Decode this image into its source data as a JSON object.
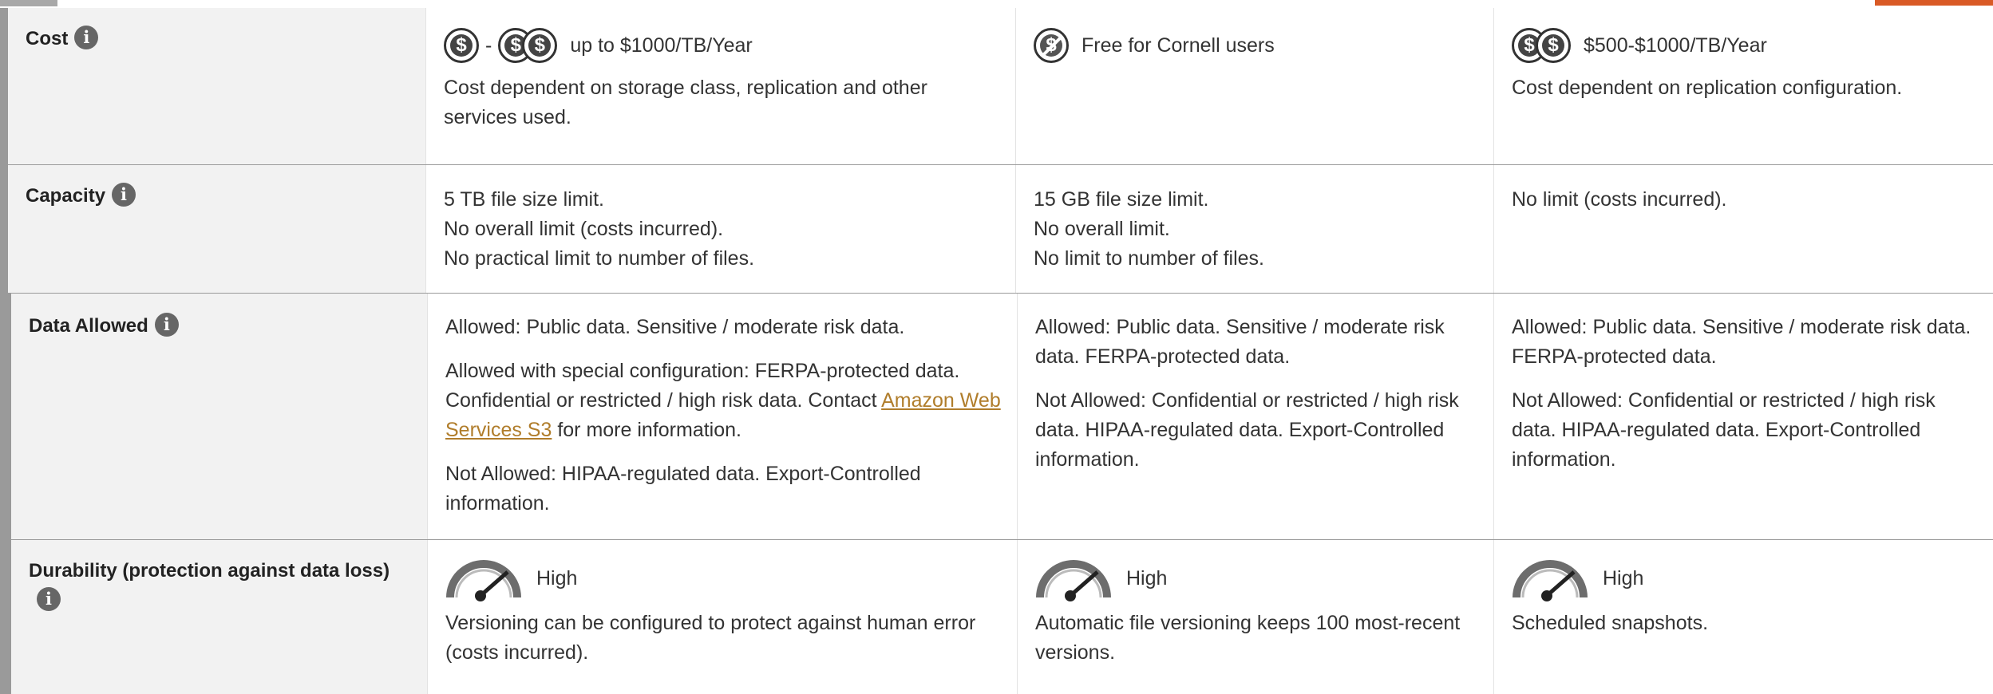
{
  "rows": {
    "cost": {
      "label": "Cost",
      "col1": {
        "range_text": "up to $1000/TB/Year",
        "desc": "Cost dependent on storage class, replication and other services used."
      },
      "col2": {
        "range_text": "Free for Cornell users"
      },
      "col3": {
        "range_text": "$500-$1000/TB/Year",
        "desc": "Cost dependent on replication configuration."
      }
    },
    "capacity": {
      "label": "Capacity",
      "col1": [
        "5 TB file size limit.",
        "No overall limit (costs incurred).",
        "No practical limit to number of files."
      ],
      "col2": [
        "15 GB file size limit.",
        "No overall limit.",
        "No limit to number of files."
      ],
      "col3": [
        "No limit (costs incurred)."
      ]
    },
    "data_allowed": {
      "label": "Data Allowed",
      "col1": {
        "p1": "Allowed: Public data. Sensitive / moderate risk data.",
        "p2_pre": "Allowed with special configuration: FERPA-protected data. Confidential or restricted / high risk data. Contact ",
        "p2_link": "Amazon Web Services S3",
        "p2_post": " for more information.",
        "p3": "Not Allowed: HIPAA-regulated data. Export-Controlled information."
      },
      "col2": {
        "p1": "Allowed: Public data. Sensitive / moderate risk data. FERPA-protected data.",
        "p2": "Not Allowed: Confidential or restricted / high risk data. HIPAA-regulated data. Export-Controlled information."
      },
      "col3": {
        "p1": "Allowed: Public data. Sensitive / moderate risk data. FERPA-protected data.",
        "p2": "Not Allowed: Confidential or restricted / high risk data. HIPAA-regulated data. Export-Controlled information."
      }
    },
    "durability": {
      "label": "Durability (protection against data loss)",
      "col1": {
        "level": "High",
        "desc": "Versioning can be configured to protect against human error (costs incurred)."
      },
      "col2": {
        "level": "High",
        "desc": "Automatic file versioning keeps 100 most-recent versions."
      },
      "col3": {
        "level": "High",
        "desc": "Scheduled snapshots."
      }
    }
  },
  "symbols": {
    "currency": "$",
    "dash": "-",
    "info": "i"
  },
  "icons": [
    "info-icon",
    "dollar-coin-icon",
    "free-coin-icon",
    "gauge-high-icon"
  ],
  "colors": {
    "link": "#b07d2b",
    "accent_tab": "#d95a25",
    "header_bg": "#f2f2f2"
  }
}
